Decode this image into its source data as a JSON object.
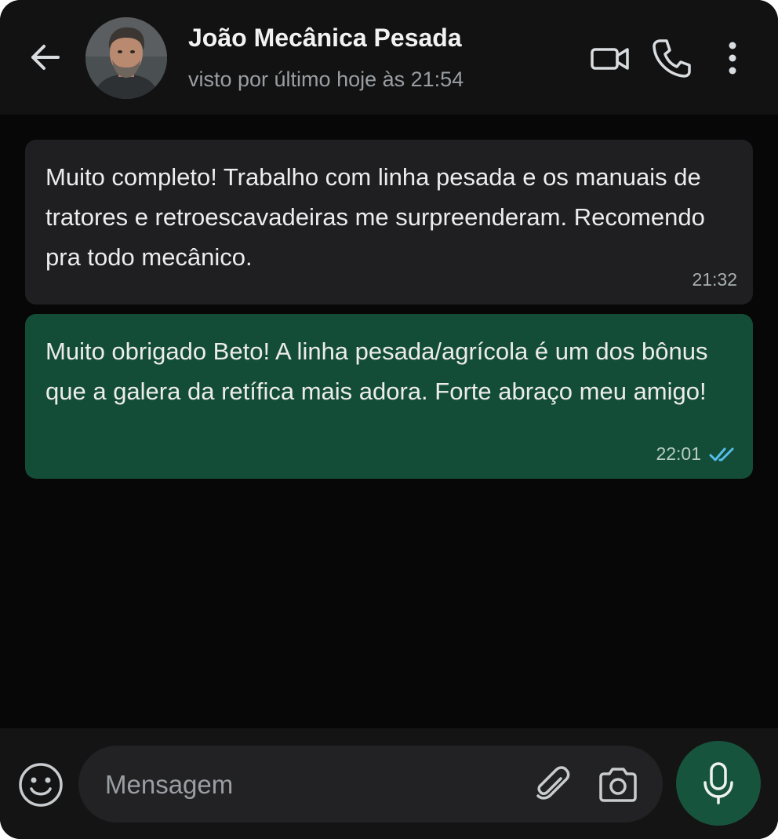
{
  "header": {
    "contact_name": "João Mecânica Pesada",
    "status": "visto por último hoje às 21:54",
    "icons": [
      "back-arrow-icon",
      "video-call-icon",
      "phone-call-icon",
      "more-vert-icon"
    ]
  },
  "messages": [
    {
      "direction": "incoming",
      "text": "Muito completo! Trabalho com linha pesada e os manuais de tratores e retroescavadeiras me surpreenderam. Recomendo pra todo mecânico.",
      "time": "21:32"
    },
    {
      "direction": "outgoing",
      "text": "Muito obrigado Beto! A linha pesada/agrícola é um dos bônus que a galera da retífica mais adora. Forte abraço meu amigo!",
      "time": "22:01",
      "status_icon": "double-check-read-icon"
    }
  ],
  "composer": {
    "placeholder": "Mensagem",
    "icons": [
      "emoji-icon",
      "attach-icon",
      "camera-icon",
      "mic-icon"
    ]
  },
  "colors": {
    "header_bg": "#121212",
    "chat_bg": "#070707",
    "incoming_bubble": "#1f1f21",
    "outgoing_bubble": "#144d37",
    "read_ticks": "#53bdeb",
    "mic_button": "#17543d"
  }
}
